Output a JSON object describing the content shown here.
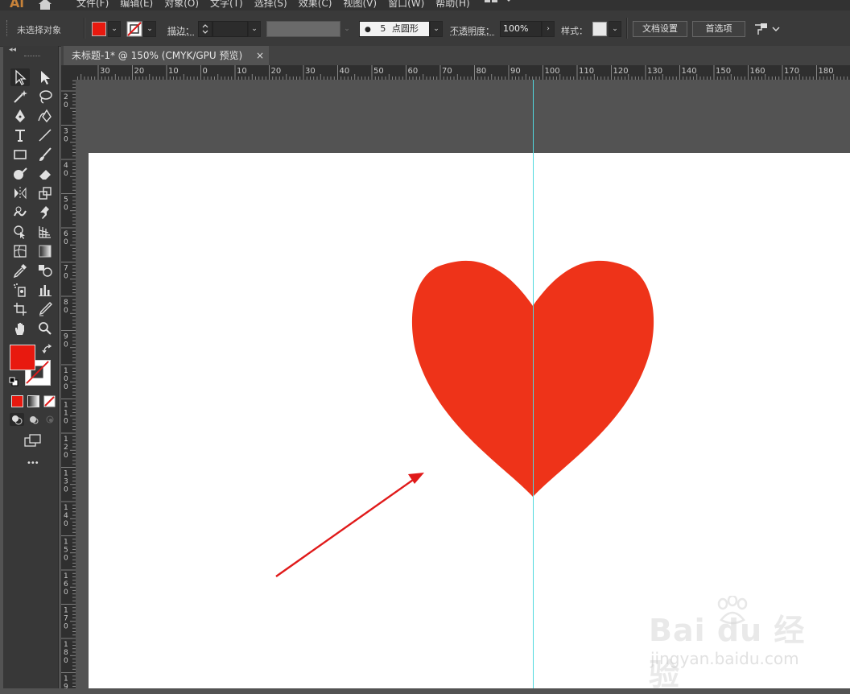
{
  "app": {
    "logo_text": "Ai",
    "menus": [
      "文件(F)",
      "编辑(E)",
      "对象(O)",
      "文字(T)",
      "选择(S)",
      "效果(C)",
      "视图(V)",
      "窗口(W)",
      "帮助(H)"
    ],
    "workspace_icon": "workspace-switcher-icon"
  },
  "control_bar": {
    "selection_status": "未选择对象",
    "fill_color": "#e8190f",
    "stroke_label": "描边：",
    "stroke_value": "",
    "brush_dot": "●",
    "brush_size": "5",
    "brush_name": "点圆形",
    "opacity_label": "不透明度：",
    "opacity_value": "100%",
    "style_label": "样式：",
    "doc_setup_button": "文档设置",
    "preferences_button": "首选项"
  },
  "document": {
    "tab_title": "未标题-1* @ 150% (CMYK/GPU 预览)",
    "close_glyph": "×"
  },
  "rulers": {
    "horizontal_labels": [
      "30",
      "20",
      "10",
      "0",
      "10",
      "20",
      "30",
      "40",
      "50",
      "60",
      "70",
      "80",
      "90",
      "100",
      "110",
      "120",
      "130",
      "140",
      "150",
      "160",
      "170",
      "180"
    ],
    "vertical_labels": [
      "2 0",
      "3 0",
      "4 0",
      "5 0",
      "6 0",
      "7 0",
      "8 0",
      "9 0",
      "1 0 0",
      "1 1 0",
      "1 2 0",
      "1 3 0",
      "1 4 0",
      "1 5 0",
      "1 6 0",
      "1 7 0",
      "1 8 0",
      "1 9 0"
    ]
  },
  "colors": {
    "heart": "#ee3319",
    "arrow": "#e01a1a",
    "guide": "#51d8df",
    "fill_swatch": "#e8190f"
  },
  "watermark": {
    "brand": "Bai du 经验",
    "url": "jingyan.baidu.com"
  },
  "toolbox": {
    "collapse_glyph": "◂◂",
    "more_glyph": "•••"
  }
}
